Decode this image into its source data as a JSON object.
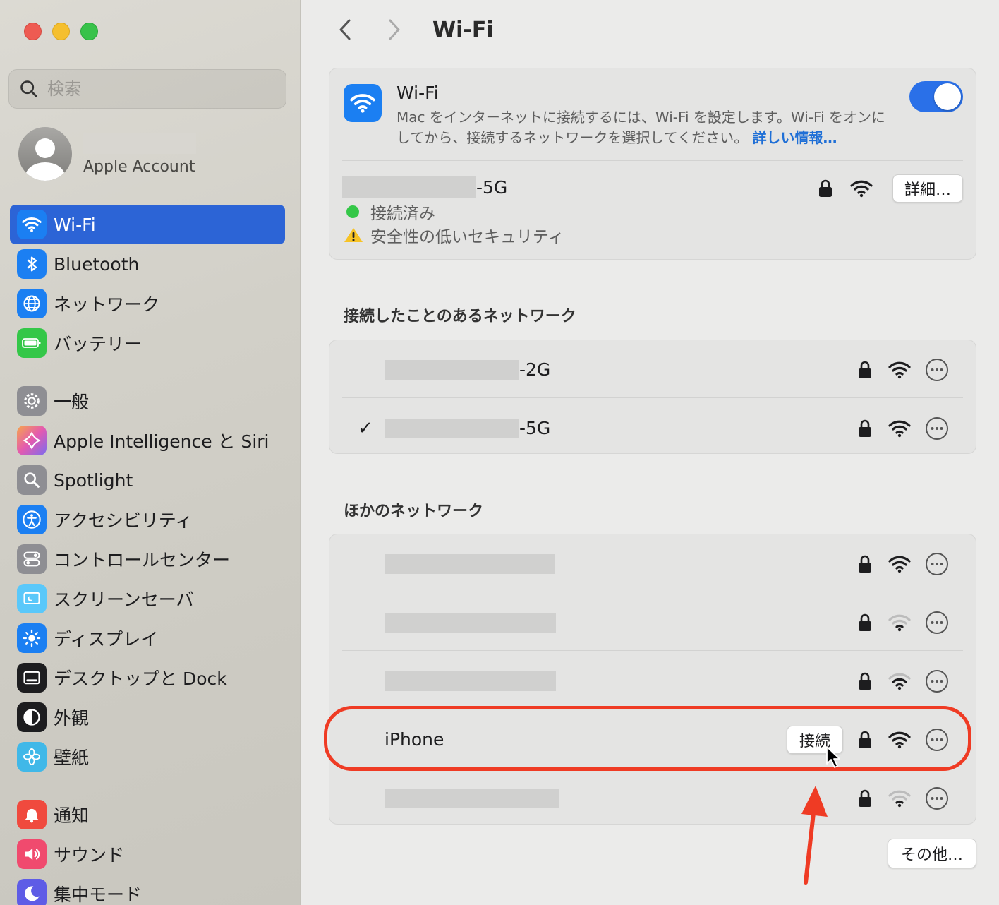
{
  "sidebar": {
    "search": {
      "placeholder": "検索"
    },
    "account": {
      "label": "Apple Account"
    },
    "items": [
      {
        "label": "Wi-Fi",
        "icon": "wifi-icon",
        "color": "#1b7ff2",
        "active": true
      },
      {
        "label": "Bluetooth",
        "icon": "bluetooth-icon",
        "color": "#1b7ff2"
      },
      {
        "label": "ネットワーク",
        "icon": "globe-icon",
        "color": "#1b7ff2"
      },
      {
        "label": "バッテリー",
        "icon": "battery-icon",
        "color": "#34c748"
      },
      {
        "label": "一般",
        "icon": "gear-icon",
        "color": "#8e8e93"
      },
      {
        "label": "Apple Intelligence と Siri",
        "icon": "siri-icon",
        "color": "#c868e8"
      },
      {
        "label": "Spotlight",
        "icon": "spotlight-icon",
        "color": "#8e8e93"
      },
      {
        "label": "アクセシビリティ",
        "icon": "accessibility-icon",
        "color": "#1b7ff2"
      },
      {
        "label": "コントロールセンター",
        "icon": "control-center-icon",
        "color": "#8e8e93"
      },
      {
        "label": "スクリーンセーバ",
        "icon": "screensaver-icon",
        "color": "#5ac8fa"
      },
      {
        "label": "ディスプレイ",
        "icon": "display-icon",
        "color": "#1b7ff2"
      },
      {
        "label": "デスクトップと Dock",
        "icon": "dock-icon",
        "color": "#1d1d1f"
      },
      {
        "label": "外観",
        "icon": "appearance-icon",
        "color": "#1d1d1f"
      },
      {
        "label": "壁紙",
        "icon": "wallpaper-icon",
        "color": "#40b8e8"
      },
      {
        "label": "通知",
        "icon": "notification-icon",
        "color": "#f04a3e"
      },
      {
        "label": "サウンド",
        "icon": "sound-icon",
        "color": "#f04a6e"
      },
      {
        "label": "集中モード",
        "icon": "focus-icon",
        "color": "#5e5ce6"
      }
    ]
  },
  "header": {
    "title": "Wi-Fi"
  },
  "wifi": {
    "title": "Wi-Fi",
    "description": "Mac をインターネットに接続するには、Wi-Fi を設定します。Wi-Fi をオンにしてから、接続するネットワークを選択してください。",
    "more_link": "詳しい情報…",
    "enabled": true,
    "current": {
      "suffix": "-5G",
      "status": "接続済み",
      "warning": "安全性の低いセキュリティ",
      "details_button": "詳細…"
    }
  },
  "known": {
    "title": "接続したことのあるネットワーク",
    "rows": [
      {
        "suffix": "-2G",
        "checked": false
      },
      {
        "suffix": "-5G",
        "checked": true
      }
    ]
  },
  "other": {
    "title": "ほかのネットワーク",
    "iphone_name": "iPhone",
    "connect_button": "接続",
    "more_button": "その他…"
  },
  "colors": {
    "accent": "#2c64d6",
    "toggle": "#2a70e8",
    "annotation": "#ef3b24",
    "link": "#1f6fd6"
  }
}
